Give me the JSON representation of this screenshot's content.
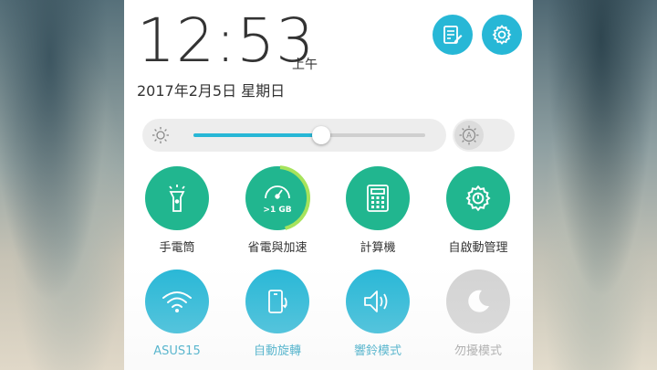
{
  "clock": {
    "time": "12:53",
    "ampm": "上午",
    "date": "2017年2月5日 星期日"
  },
  "header": {
    "edit_icon": "edit-icon",
    "settings_icon": "gear-icon"
  },
  "brightness": {
    "level": 0.55,
    "auto_label": "A",
    "auto_enabled": false
  },
  "tiles": [
    {
      "label": "手電筒",
      "icon": "flashlight-icon",
      "color": "#21b68f",
      "active": true
    },
    {
      "label": "省電與加速",
      "icon": "speedometer-icon",
      "badge": ">1 GB",
      "color": "#21b68f",
      "active": true
    },
    {
      "label": "計算機",
      "icon": "calculator-icon",
      "color": "#21b68f",
      "active": true
    },
    {
      "label": "自啟動管理",
      "icon": "gear-icon",
      "color": "#21b68f",
      "active": true
    },
    {
      "label": "ASUS15",
      "icon": "wifi-icon",
      "color": "#27b7d6",
      "active": true
    },
    {
      "label": "自動旋轉",
      "icon": "rotate-icon",
      "color": "#27b7d6",
      "active": true
    },
    {
      "label": "響鈴模式",
      "icon": "speaker-icon",
      "color": "#27b7d6",
      "active": true
    },
    {
      "label": "勿擾模式",
      "icon": "moon-icon",
      "color": "#d3d3d3",
      "active": false
    }
  ],
  "colors": {
    "accent": "#27b7d6",
    "tool": "#21b68f",
    "inactive": "#d3d3d3"
  }
}
